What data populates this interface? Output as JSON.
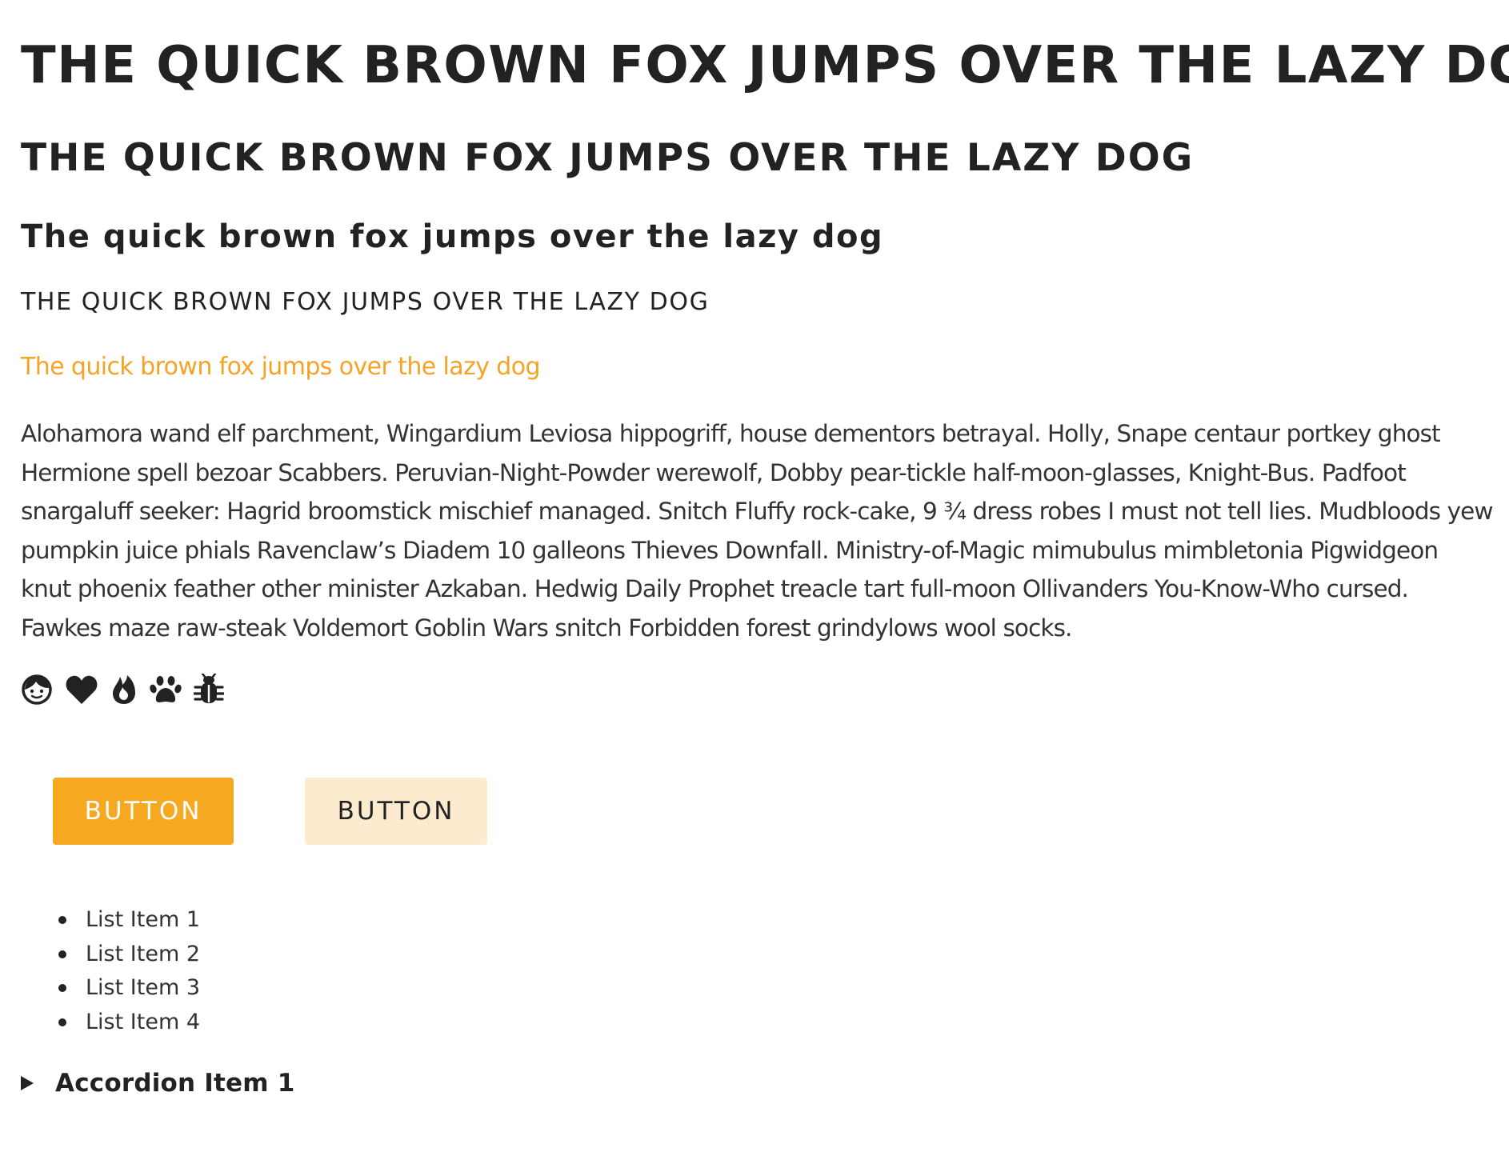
{
  "headings": {
    "h1": "THE QUICK BROWN FOX JUMPS OVER THE LAZY DOG",
    "h2": "THE QUICK BROWN FOX JUMPS OVER THE LAZY DOG",
    "h3": "The quick brown fox jumps over the lazy dog",
    "h4": "THE QUICK BROWN FOX JUMPS OVER THE LAZY DOG",
    "lead": "The quick brown fox jumps over the lazy dog"
  },
  "paragraph": "Alohamora wand elf parchment, Wingardium Leviosa hippogriff, house dementors betrayal. Holly, Snape centaur portkey ghost Hermione spell bezoar Scabbers. Peruvian-Night-Powder werewolf, Dobby pear-tickle half-moon-glasses, Knight-Bus. Padfoot snargaluff seeker: Hagrid broomstick mischief managed. Snitch Fluffy rock-cake, 9 ¾ dress robes I must not tell lies. Mudbloods yew pumpkin juice phials Ravenclaw’s Diadem 10 galleons Thieves Downfall. Ministry-of-Magic mimubulus mimbletonia Pigwidgeon knut phoenix feather other minister Azkaban. Hedwig Daily Prophet treacle tart full-moon Ollivanders You-Know-Who cursed. Fawkes maze raw-steak Voldemort Goblin Wars snitch Forbidden forest grindylows wool socks.",
  "icons": [
    "face-icon",
    "heart-icon",
    "fire-icon",
    "paw-icon",
    "bug-icon"
  ],
  "buttons": {
    "primary": "BUTTON",
    "secondary": "BUTTON"
  },
  "list": [
    "List Item 1",
    "List Item 2",
    "List Item 3",
    "List Item 4"
  ],
  "accordion": {
    "label": "Accordion Item 1",
    "expanded": false
  },
  "colors": {
    "text": "#222222",
    "accent": "#f4a326",
    "button_primary_bg": "#f6a821",
    "button_secondary_bg": "#fdebcf"
  }
}
